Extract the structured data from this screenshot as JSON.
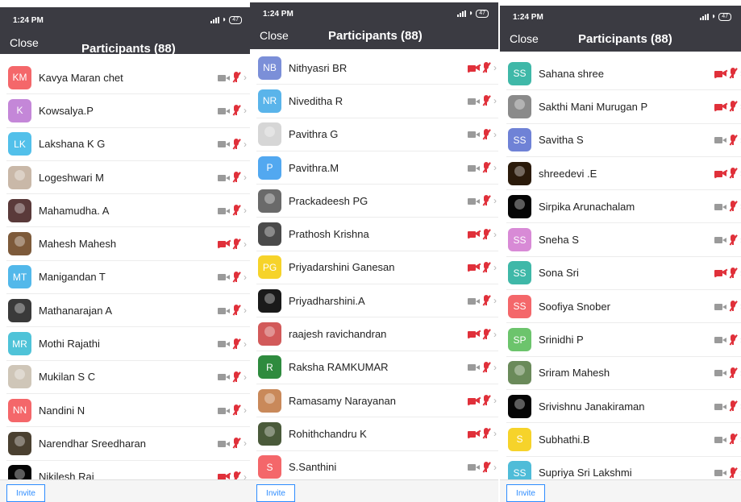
{
  "colors": {
    "header_bg": "#3b3b42",
    "muted_red": "#e0303a",
    "video_on_gray": "#9a9a9a",
    "invite_blue": "#2d8cff"
  },
  "icons": {
    "video": "video-camera-icon",
    "audio": "muted-microphone-icon",
    "more": "chevron-right-icon"
  },
  "panels": [
    {
      "status": {
        "time": "1:24 PM",
        "battery": "47"
      },
      "close_label": "Close",
      "title": "Participants (88)",
      "invite_label": "Invite",
      "participants": [
        {
          "name": "Kavya Maran chet",
          "initials": "KM",
          "avatar_color": "#f4676a",
          "video_off": false
        },
        {
          "name": "Kowsalya.P",
          "initials": "K",
          "avatar_color": "#c487d8",
          "video_off": false
        },
        {
          "name": "Lakshana K G",
          "initials": "LK",
          "avatar_color": "#52c0ea",
          "video_off": false
        },
        {
          "name": "Logeshwari M",
          "initials": "",
          "avatar_color": "#c9b8a8",
          "video_off": false
        },
        {
          "name": "Mahamudha. A",
          "initials": "",
          "avatar_color": "#5a3a3a",
          "video_off": false
        },
        {
          "name": "Mahesh Mahesh",
          "initials": "",
          "avatar_color": "#7d5a3a",
          "video_off": true
        },
        {
          "name": "Manigandan T",
          "initials": "MT",
          "avatar_color": "#52b8ea",
          "video_off": false
        },
        {
          "name": "Mathanarajan A",
          "initials": "",
          "avatar_color": "#3a3a3a",
          "video_off": false
        },
        {
          "name": "Mothi Rajathi",
          "initials": "MR",
          "avatar_color": "#4fc3d8",
          "video_off": false
        },
        {
          "name": "Mukilan S C",
          "initials": "",
          "avatar_color": "#cfc6b8",
          "video_off": false
        },
        {
          "name": "Nandini N",
          "initials": "NN",
          "avatar_color": "#f4676a",
          "video_off": false
        },
        {
          "name": "Narendhar Sreedharan",
          "initials": "",
          "avatar_color": "#4a4030",
          "video_off": false
        },
        {
          "name": "Nikilesh Raj",
          "initials": "",
          "avatar_color": "#050505",
          "video_off": true
        }
      ]
    },
    {
      "status": {
        "time": "1:24 PM",
        "battery": "47"
      },
      "close_label": "Close",
      "title": "Participants (88)",
      "invite_label": "Invite",
      "participants": [
        {
          "name": "Nithyasri BR",
          "initials": "NB",
          "avatar_color": "#7b8fd8",
          "video_off": true
        },
        {
          "name": "Niveditha R",
          "initials": "NR",
          "avatar_color": "#5ab4ea",
          "video_off": false
        },
        {
          "name": "Pavithra G",
          "initials": "",
          "avatar_color": "#d6d6d6",
          "video_off": false
        },
        {
          "name": "Pavithra.M",
          "initials": "P",
          "avatar_color": "#52a8f0",
          "video_off": false
        },
        {
          "name": "Prackadeesh PG",
          "initials": "",
          "avatar_color": "#6a6a6a",
          "video_off": false
        },
        {
          "name": "Prathosh Krishna",
          "initials": "",
          "avatar_color": "#4a4a4a",
          "video_off": true
        },
        {
          "name": "Priyadarshini Ganesan",
          "initials": "PG",
          "avatar_color": "#f6d32a",
          "video_off": true
        },
        {
          "name": "Priyadharshini.A",
          "initials": "",
          "avatar_color": "#1a1a1a",
          "video_off": false
        },
        {
          "name": "raajesh ravichandran",
          "initials": "",
          "avatar_color": "#d25a5a",
          "video_off": true
        },
        {
          "name": "Raksha RAMKUMAR",
          "initials": "R",
          "avatar_color": "#2e8b3e",
          "video_off": false
        },
        {
          "name": "Ramasamy Narayanan",
          "initials": "",
          "avatar_color": "#c9895a",
          "video_off": true
        },
        {
          "name": "Rohithchandru K",
          "initials": "",
          "avatar_color": "#4a5a3a",
          "video_off": true
        },
        {
          "name": "S.Santhini",
          "initials": "S",
          "avatar_color": "#f4676a",
          "video_off": false
        }
      ]
    },
    {
      "status": {
        "time": "1:24 PM",
        "battery": "47"
      },
      "close_label": "Close",
      "title": "Participants (88)",
      "invite_label": "Invite",
      "participants": [
        {
          "name": "Sahana shree",
          "initials": "SS",
          "avatar_color": "#3fb8a8",
          "video_off": true
        },
        {
          "name": "Sakthi Mani Murugan P",
          "initials": "",
          "avatar_color": "#8a8a8a",
          "video_off": true
        },
        {
          "name": "Savitha S",
          "initials": "SS",
          "avatar_color": "#6f82d6",
          "video_off": false
        },
        {
          "name": "shreedevi .E",
          "initials": "",
          "avatar_color": "#2a1a0a",
          "video_off": true
        },
        {
          "name": "Sirpika Arunachalam",
          "initials": "",
          "avatar_color": "#050505",
          "video_off": false
        },
        {
          "name": "Sneha S",
          "initials": "SS",
          "avatar_color": "#d88ad6",
          "video_off": false
        },
        {
          "name": "Sona Sri",
          "initials": "SS",
          "avatar_color": "#3fb8a8",
          "video_off": true
        },
        {
          "name": "Soofiya Snober",
          "initials": "SS",
          "avatar_color": "#f4676a",
          "video_off": false
        },
        {
          "name": "Srinidhi P",
          "initials": "SP",
          "avatar_color": "#6cc46c",
          "video_off": false
        },
        {
          "name": "Sriram Mahesh",
          "initials": "",
          "avatar_color": "#6a8a5a",
          "video_off": false
        },
        {
          "name": "Srivishnu Janakiraman",
          "initials": "",
          "avatar_color": "#050505",
          "video_off": false
        },
        {
          "name": "Subhathi.B",
          "initials": "S",
          "avatar_color": "#f6d32a",
          "video_off": false
        },
        {
          "name": "Supriya Sri Lakshmi",
          "initials": "SS",
          "avatar_color": "#4fbcd8",
          "video_off": false
        }
      ]
    }
  ]
}
